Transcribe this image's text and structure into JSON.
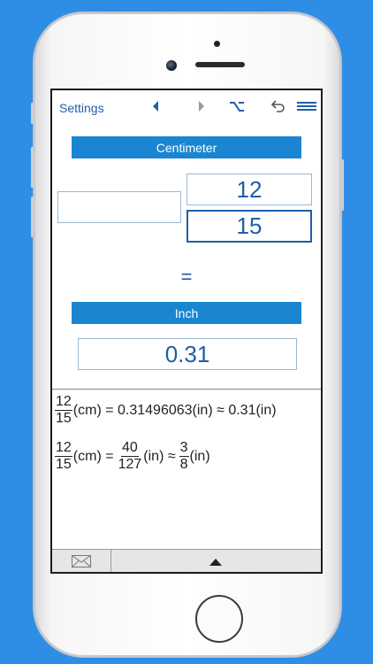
{
  "toolbar": {
    "settings_label": "Settings",
    "icons": [
      "back-arrow-icon",
      "forward-arrow-icon",
      "option-key-icon",
      "undo-icon",
      "menu-icon"
    ]
  },
  "converter": {
    "from_unit": "Centimeter",
    "input_value": "",
    "numerator": "12",
    "denominator": "15",
    "equals_sign": "=",
    "to_unit": "Inch",
    "result": "0.31"
  },
  "formulas": {
    "line1": {
      "num": "12",
      "den": "15",
      "text": "(cm) = 0.31496063(in) ≈ 0.31(in)"
    },
    "line2": {
      "num": "12",
      "den": "15",
      "mid": "(cm) =",
      "num2": "40",
      "den2": "127",
      "mid2": "(in) ≈",
      "num3": "3",
      "den3": "8",
      "tail": "(in)"
    }
  },
  "bottom_bar": {
    "icons": [
      "mail-icon",
      "expand-up-icon"
    ]
  },
  "colors": {
    "background": "#2e8ee6",
    "accent": "#1a86d2",
    "text_blue": "#1f5ea8"
  }
}
